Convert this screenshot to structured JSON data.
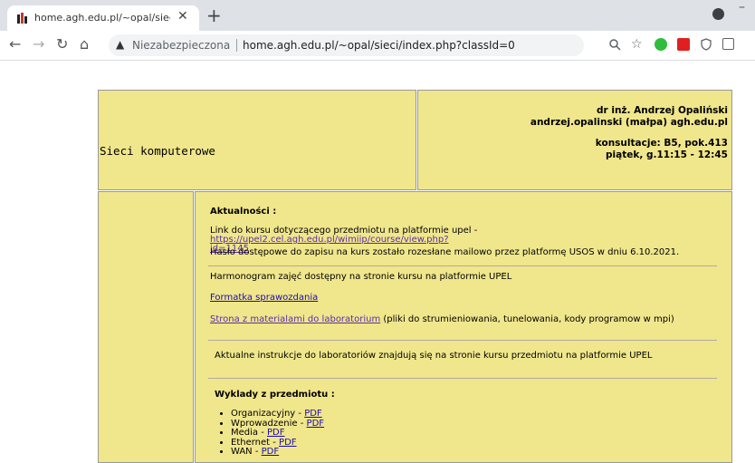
{
  "browser": {
    "tab_title": "home.agh.edu.pl/~opal/sieci/ind",
    "tab_close": "✕",
    "new_tab": "+",
    "security_label": "Niezabezpieczona",
    "url": "home.agh.edu.pl/~opal/sieci/index.php?classId=0",
    "back": "←",
    "forward": "→",
    "reload": "↻",
    "home": "⌂"
  },
  "header": {
    "title": "Sieci komputerowe",
    "author_name": "dr inż. Andrzej Opaliński",
    "author_email": "andrzej.opalinski (małpa) agh.edu.pl",
    "consult_room": "konsultacje: B5, pok.413",
    "consult_time": "piątek, g.11:15 - 12:45"
  },
  "main": {
    "news_heading": "Aktualności :",
    "upel_text": "Link do kursu dotyczącego przedmiotu na platformie upel - ",
    "upel_link_1": "https://upel2.cel.agh.edu.pl/wimiip/course/view.php?",
    "upel_link_2": "id=1145",
    "password_text": "Hasło dostępowe do zapisu na kurs zostało rozesłane mailowo przez platformę USOS w dniu 6.10.2021.",
    "schedule_text": "Harmonogram zajęć dostępny na stronie kursu na platformie UPEL",
    "report_link": "Formatka sprawozdania",
    "lab_link": "Strona z materialami do laboratorium",
    "lab_note": " (pliki do strumieniowania, tunelowania, kody programow w mpi)",
    "instructions_text": "Aktualne instrukcje do laboratoriów znajdują się na stronie kursu przedmiotu na platformie UPEL",
    "lectures_heading": "Wyklady z przedmiotu :",
    "lectures": [
      {
        "name": "Organizacyjny - ",
        "link": "PDF"
      },
      {
        "name": "Wprowadzenie - ",
        "link": "PDF"
      },
      {
        "name": "Media - ",
        "link": "PDF"
      },
      {
        "name": "Ethernet - ",
        "link": "PDF"
      },
      {
        "name": "WAN - ",
        "link": "PDF"
      }
    ]
  }
}
